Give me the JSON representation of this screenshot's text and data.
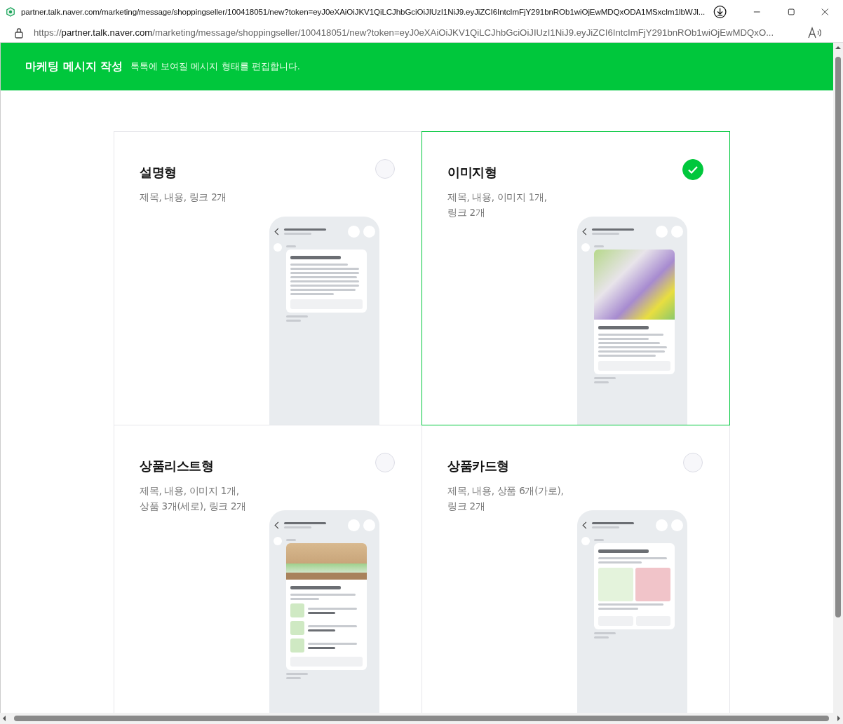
{
  "browser": {
    "tab_title": "partner.talk.naver.com/marketing/message/shoppingseller/100418051/new?token=eyJ0eXAiOiJKV1QiLCJhbGciOiJIUzI1NiJ9.eyJiZCI6IntcImFjY291bnROb1wiOjEwMDQxODA1MSxcIm1lbWJl...",
    "url_scheme": "https://",
    "url_host": "partner.talk.naver.com",
    "url_path": "/marketing/message/shoppingseller/100418051/new?token=eyJ0eXAiOiJKV1QiLCJhbGciOiJIUzI1NiJ9.eyJiZCI6IntcImFjY291bnROb1wiOjEwMDQxO..."
  },
  "header": {
    "title": "마케팅 메시지 작성",
    "subtitle": "톡톡에 보여질 메시지 형태를 편집합니다."
  },
  "cards": [
    {
      "title": "설명형",
      "description": [
        "제목, 내용, 링크 2개"
      ],
      "selected": false,
      "kind": "text"
    },
    {
      "title": "이미지형",
      "description": [
        "제목, 내용, 이미지 1개,",
        "링크 2개"
      ],
      "selected": true,
      "kind": "image"
    },
    {
      "title": "상품리스트형",
      "description": [
        "제목, 내용, 이미지 1개,",
        "상품 3개(세로), 링크 2개"
      ],
      "selected": false,
      "kind": "list"
    },
    {
      "title": "상품카드형",
      "description": [
        "제목, 내용, 상품 6개(가로),",
        "링크 2개"
      ],
      "selected": false,
      "kind": "card"
    }
  ]
}
